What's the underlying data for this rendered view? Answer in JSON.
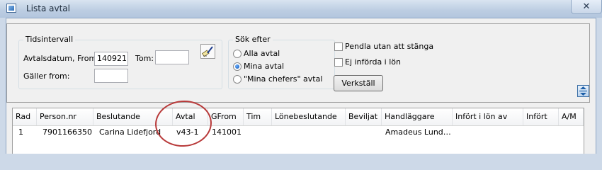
{
  "window": {
    "title": "Lista avtal",
    "close_glyph": "✕"
  },
  "filters": {
    "period_group": {
      "legend": "Tidsintervall",
      "from_label": "Avtalsdatum, From:",
      "from_value": "140921",
      "to_label": "Tom:",
      "to_value": "",
      "valid_from_label": "Gäller from:",
      "valid_from_value": ""
    },
    "search_group": {
      "legend": "Sök efter",
      "options": [
        {
          "label": "Alla avtal",
          "checked": false
        },
        {
          "label": "Mina avtal",
          "checked": true
        },
        {
          "label": "\"Mina chefers\" avtal",
          "checked": false
        }
      ]
    },
    "checkboxes": [
      {
        "label": "Pendla utan att stänga",
        "checked": false
      },
      {
        "label": "Ej införda i lön",
        "checked": false
      }
    ],
    "apply_button": "Verkställ",
    "clear_icon": "eraser-pen-icon",
    "expand_icon": "expand-collapse-icon"
  },
  "grid": {
    "columns": [
      "Rad",
      "Person.nr",
      "Beslutande",
      "Avtal",
      "GFrom",
      "Tim",
      "Lönebeslutande",
      "Beviljat",
      "Handläggare",
      "Infört i lön av",
      "Infört",
      "A/M"
    ],
    "rows": [
      [
        "1",
        "7901166350",
        "Carina Lidefjord",
        "v43-1",
        "141001",
        "",
        "",
        "",
        "Amadeus Lund…",
        "",
        "",
        ""
      ]
    ]
  },
  "colors": {
    "annotation_ellipse": "#b83a3a",
    "titlebar": "#bccde2"
  }
}
